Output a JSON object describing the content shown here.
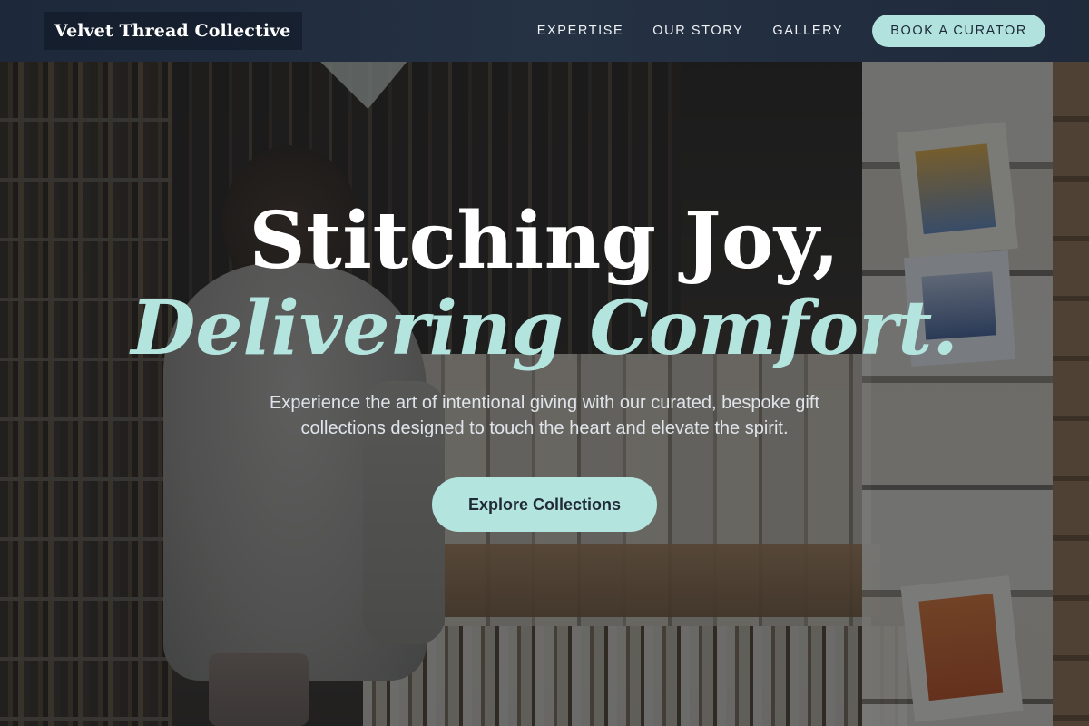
{
  "nav": {
    "brand": "Velvet Thread Collective",
    "links": [
      "EXPERTISE",
      "OUR STORY",
      "GALLERY"
    ],
    "book_button": "BOOK A CURATOR"
  },
  "hero": {
    "headline_line1": "Stitching Joy,",
    "headline_line2": "Delivering Comfort.",
    "subtitle": "Experience the art of intentional giving with our curated, bespoke gift collections designed to touch the heart and elevate the spirit.",
    "cta_label": "Explore Collections"
  },
  "colors": {
    "accent": "#b4e4de",
    "nav_background": "#1f2a3b",
    "heading_text": "#ffffff"
  }
}
